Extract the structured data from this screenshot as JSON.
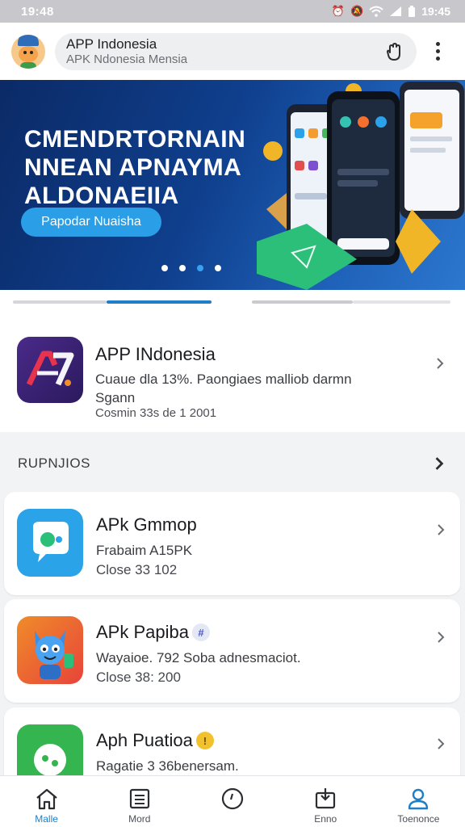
{
  "status_bar": {
    "time": "19:48",
    "right_time": "19:45"
  },
  "app_bar": {
    "title": "APP Indonesia",
    "subtitle": "APK Ndonesia Mensia"
  },
  "banner": {
    "title_lines": [
      "CMENDRTORNAIN",
      "NNEAN APNAYMA",
      "ALDONAEIIA"
    ],
    "button_label": "Papodar Nuaisha",
    "dots": 4,
    "active_dot": 2
  },
  "featured": {
    "name": "APP INdonesia",
    "description": "Cuaue dla 13%. Paongiaes malliob darmn Sgann",
    "meta": "Cosmin 33s de 1 2001"
  },
  "section": {
    "title": "RUPNJIOS"
  },
  "apps": [
    {
      "name": "APk Gmmop",
      "description": "Frabaim A15PK",
      "meta": "Close 33 102",
      "badge": ""
    },
    {
      "name": "APk Papiba",
      "description": "Wayaioe. 792 Soba adnesmaciot.",
      "meta": "Close 38: 200",
      "badge": "#"
    },
    {
      "name": "Aph Puatioa",
      "description": "Ragatie 3 36benersam.",
      "meta": "",
      "badge": "!"
    }
  ],
  "bottom_nav": [
    {
      "label": "Malle",
      "icon": "home-icon",
      "active": true
    },
    {
      "label": "Mord",
      "icon": "list-icon",
      "active": false
    },
    {
      "label": "",
      "icon": "clock-icon",
      "active": false
    },
    {
      "label": "Enno",
      "icon": "download-icon",
      "active": false
    },
    {
      "label": "Toenonce",
      "icon": "person-icon",
      "active": false
    }
  ],
  "colors": {
    "accent": "#1f7fc6",
    "banner_bg": "#0f3f8d",
    "banner_button": "#2a9ee6"
  }
}
